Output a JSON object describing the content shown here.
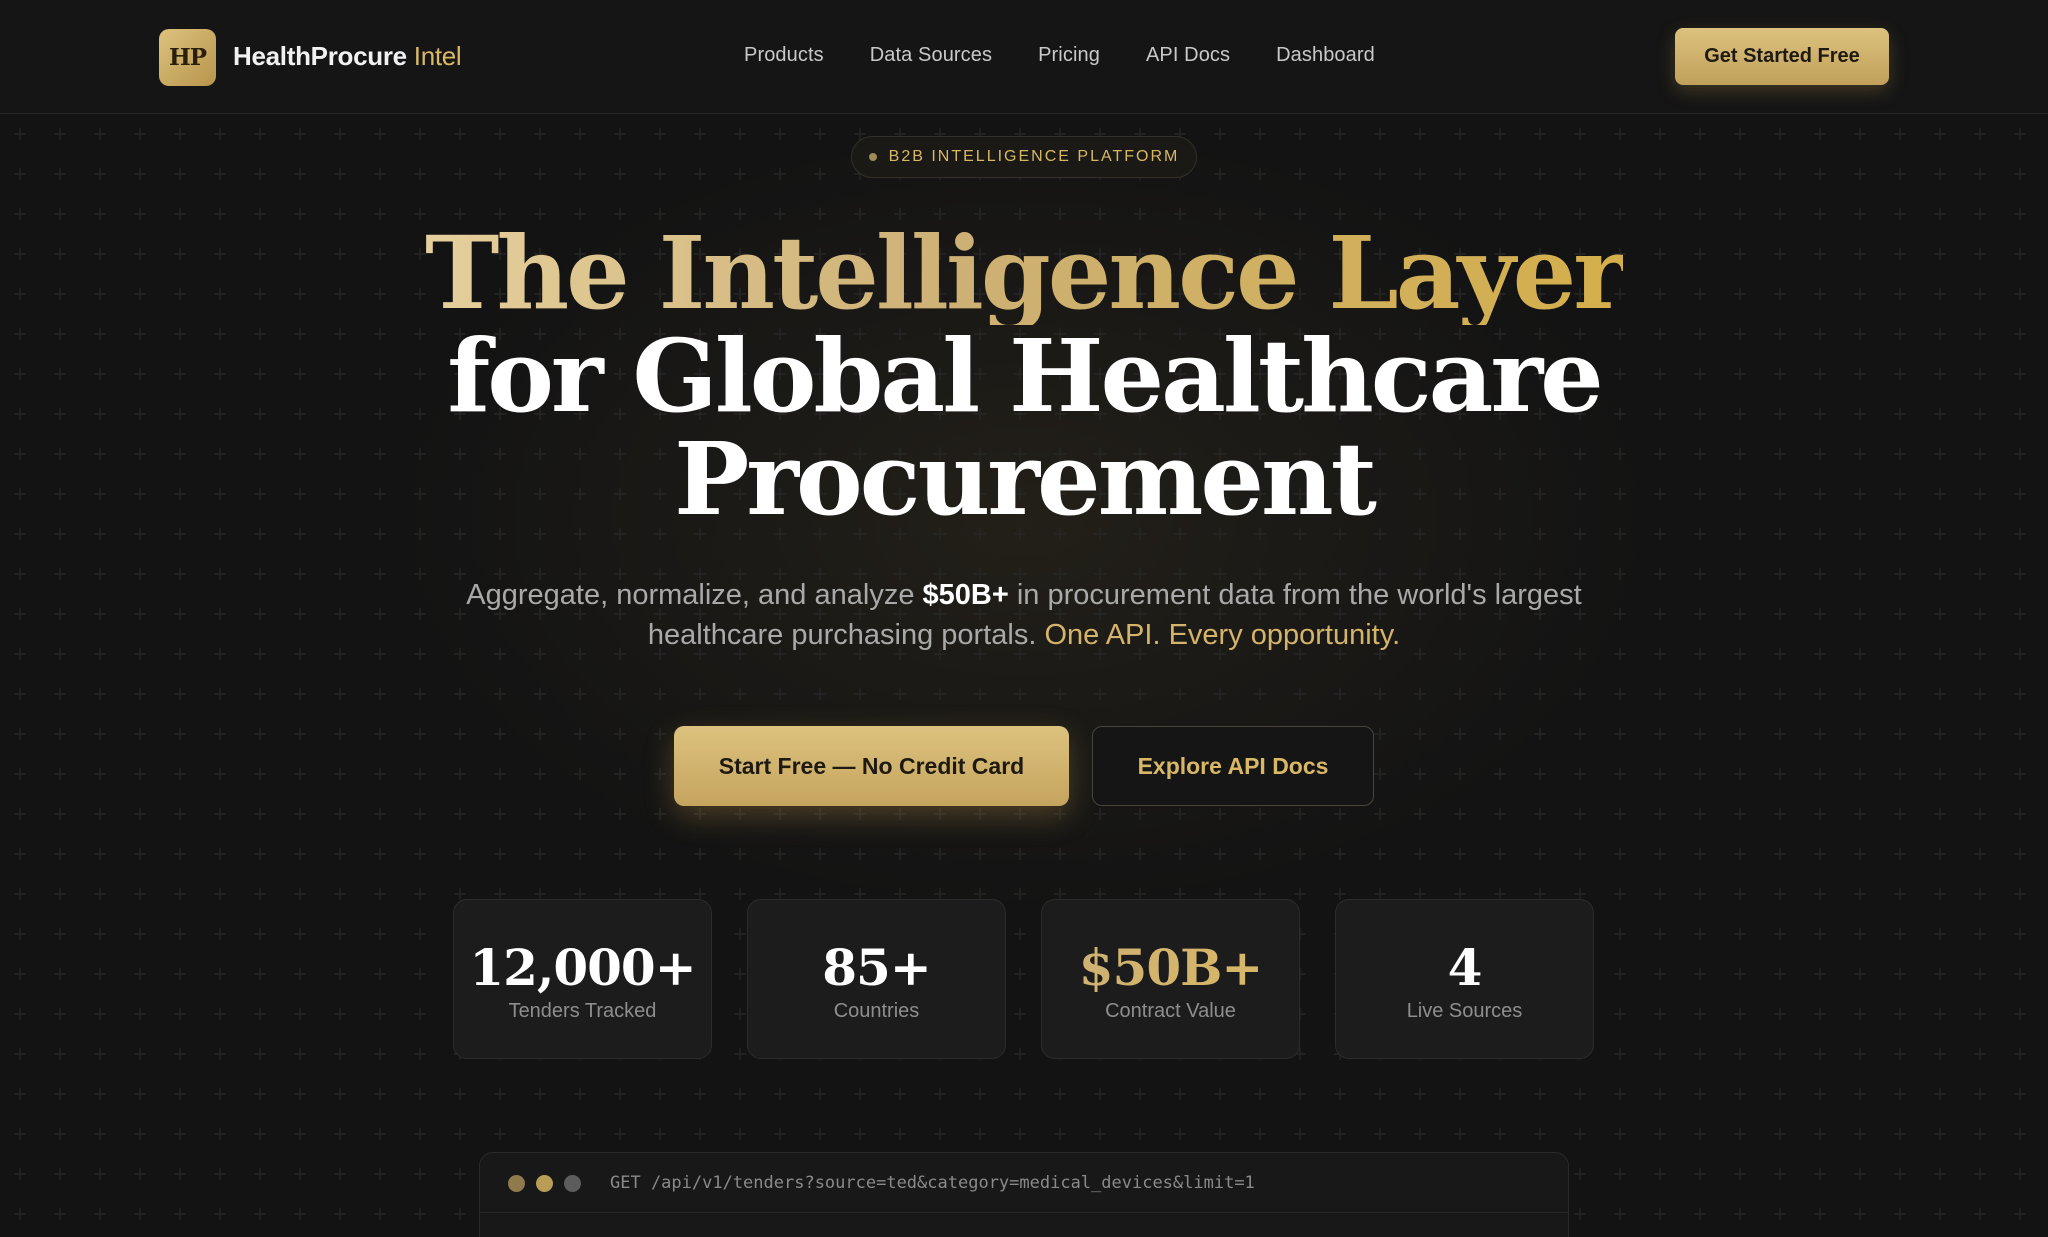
{
  "colors": {
    "background": "#131313",
    "gold": "#d9b865",
    "gold_button": "#dcc27e",
    "text_muted": "#a9a9a9"
  },
  "nav": {
    "logo_mark": "HP",
    "brand_name": "HealthProcure",
    "brand_accent": "Intel",
    "links": [
      "Products",
      "Data Sources",
      "Pricing",
      "API Docs",
      "Dashboard"
    ],
    "cta_label": "Get Started Free"
  },
  "hero": {
    "pill_label": "B2B INTELLIGENCE PLATFORM",
    "headline_gold": "The Intelligence Layer",
    "headline_white_1": "for Global Healthcare",
    "headline_white_2": "Procurement",
    "subtitle_pre": "Aggregate, normalize, and analyze",
    "subtitle_highlight": "$50B+",
    "subtitle_mid": "in procurement data from the world's largest healthcare purchasing portals.",
    "subtitle_gold": "One API. Every opportunity.",
    "primary_button": "Start Free — No Credit Card",
    "secondary_button": "Explore API Docs"
  },
  "stats": [
    {
      "value": "12,000+",
      "label": "Tenders Tracked"
    },
    {
      "value": "85+",
      "label": "Countries"
    },
    {
      "value": "$50B+",
      "label": "Contract Value"
    },
    {
      "value": "4",
      "label": "Live Sources"
    }
  ],
  "code_window": {
    "dot_colors": [
      "#8f7a4c",
      "#b99c55",
      "#5c5c5c"
    ],
    "request": "GET /api/v1/tenders?source=ted&category=medical_devices&limit=1"
  }
}
